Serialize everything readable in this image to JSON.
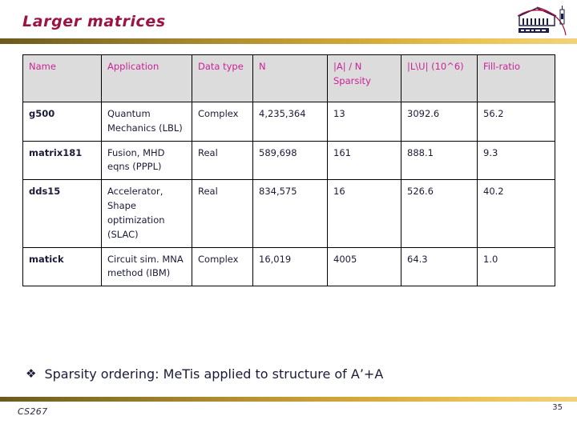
{
  "slide": {
    "title": "Larger matrices",
    "accent_title_color": "#9c1241",
    "header_text_color": "#cc2299",
    "body_text_color": "#1b1b3a",
    "divider_color": "#d8ad3c"
  },
  "logo": {
    "name": "institution-logo"
  },
  "table": {
    "columns": [
      {
        "label": "Name"
      },
      {
        "label": "Application"
      },
      {
        "label": "Data type"
      },
      {
        "label": "N"
      },
      {
        "label": "|A| / N Sparsity"
      },
      {
        "label": "|L\\U| (10^6)"
      },
      {
        "label": "Fill-ratio"
      }
    ],
    "rows": [
      {
        "name": "g500",
        "application": "Quantum Mechanics (LBL)",
        "data_type": "Complex",
        "n": "4,235,364",
        "sparsity": "13",
        "lu": "3092.6",
        "fill_ratio": "56.2"
      },
      {
        "name": "matrix181",
        "application": "Fusion, MHD eqns (PPPL)",
        "data_type": "Real",
        "n": "589,698",
        "sparsity": "161",
        "lu": "888.1",
        "fill_ratio": "9.3"
      },
      {
        "name": "dds15",
        "application": "Accelerator, Shape optimization (SLAC)",
        "data_type": "Real",
        "n": "834,575",
        "sparsity": "16",
        "lu": "526.6",
        "fill_ratio": "40.2"
      },
      {
        "name": "matick",
        "application": "Circuit sim. MNA method (IBM)",
        "data_type": "Complex",
        "n": "16,019",
        "sparsity": "4005",
        "lu": "64.3",
        "fill_ratio": "1.0"
      }
    ]
  },
  "bullet": {
    "glyph": "❖",
    "text": "Sparsity ordering: MeTis applied to structure of A’+A"
  },
  "footer": {
    "course": "CS267",
    "page_number": "35"
  }
}
